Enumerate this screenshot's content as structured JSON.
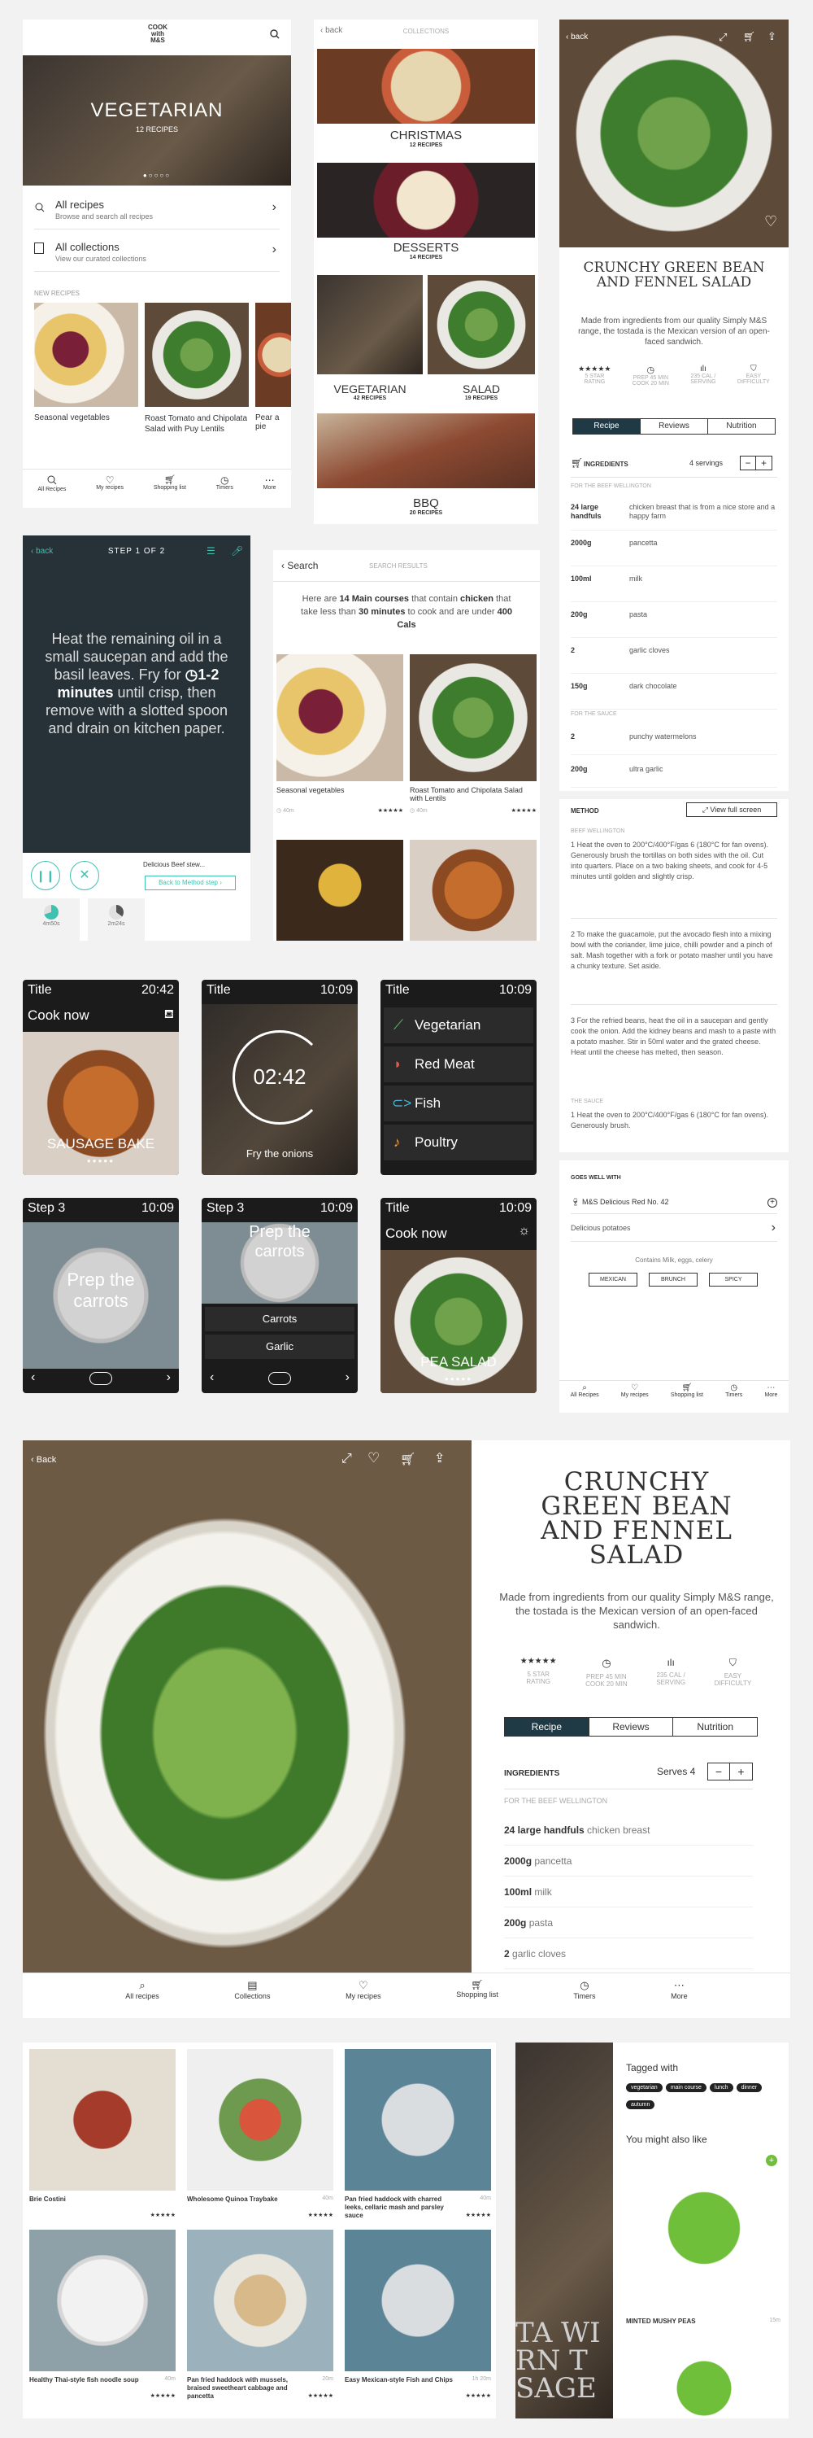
{
  "panel1": {
    "brand": "COOK\nwith\nM&S",
    "hero_title": "VEGETARIAN",
    "hero_subtitle": "12 RECIPES",
    "all_recipes": {
      "title": "All recipes",
      "subtitle": "Browse and search all recipes"
    },
    "all_collections": {
      "title": "All collections",
      "subtitle": "View our curated collections"
    },
    "new_recipes_label": "NEW RECIPES",
    "cards": [
      "Seasonal vegetables",
      "Roast Tomato and Chipolata Salad with Puy Lentils",
      "Pear a pie"
    ],
    "tabs": [
      "All Recipes",
      "My recipes",
      "Shopping list",
      "Timers",
      "More"
    ]
  },
  "panel2": {
    "back": "back",
    "title": "COLLECTIONS",
    "collections": [
      {
        "name": "CHRISTMAS",
        "count": "12 RECIPES"
      },
      {
        "name": "DESSERTS",
        "count": "14 RECIPES"
      },
      {
        "name": "VEGETARIAN",
        "count": "42 RECIPES"
      },
      {
        "name": "SALAD",
        "count": "19 RECIPES"
      },
      {
        "name": "BBQ",
        "count": "20 RECIPES"
      }
    ]
  },
  "panel3": {
    "back": "back",
    "title": "CRUNCHY GREEN BEAN AND FENNEL SALAD",
    "desc": "Made from ingredients from our quality Simply M&S range, the tostada is the Mexican version of an open-faced sandwich.",
    "stats": [
      {
        "value": "★★★★★",
        "label": "5 STAR\nRATING"
      },
      {
        "value": "◷",
        "label": "PREP 45 MIN\nCOOK 20 MIN"
      },
      {
        "value": "ılı",
        "label": "235 CAL /\nSERVING"
      },
      {
        "value": "⛉",
        "label": "EASY\nDIFFICULTY"
      }
    ],
    "tabs": [
      "Recipe",
      "Reviews",
      "Nutrition"
    ],
    "ingredients_label": "INGREDIENTS",
    "servings": "4 servings",
    "section1": "FOR THE BEEF WELLINGTON",
    "ingredients": [
      {
        "qty": "24 large\nhandfuls",
        "item": "chicken breast that is from a nice store and a happy farm"
      },
      {
        "qty": "2000g",
        "item": "pancetta"
      },
      {
        "qty": "100ml",
        "item": "milk"
      },
      {
        "qty": "200g",
        "item": "pasta"
      },
      {
        "qty": "2",
        "item": "garlic cloves"
      },
      {
        "qty": "150g",
        "item": "dark chocolate"
      }
    ],
    "section2": "FOR THE SAUCE",
    "sauce": [
      {
        "qty": "2",
        "item": "punchy watermelons"
      },
      {
        "qty": "200g",
        "item": "ultra garlic"
      }
    ],
    "method_label": "METHOD",
    "view_full": "View full screen",
    "method_section": "BEEF WELLINGTON",
    "steps": [
      "1  Heat the oven to 200°C/400°F/gas 6 (180°C for fan ovens). Generously brush the tortillas on both sides with the oil. Cut into quarters. Place on a two baking sheets, and cook for 4-5 minutes until golden and slightly crisp.",
      "2  To make the guacamole, put the avocado flesh into a mixing bowl with the coriander, lime juice, chilli powder and a pinch of salt. Mash together with a fork or potato masher until you have a chunky texture. Set aside.",
      "3  For the refried beans, heat the oil in a saucepan and gently cook the onion. Add the kidney beans and mash to a paste with a potato masher. Stir in 50ml water and the grated cheese. Heat until the cheese has melted, then season."
    ],
    "sauce_section": "THE SAUCE",
    "sauce_step": "1  Heat the oven to 200°C/400°F/gas 6 (180°C for fan ovens). Generously brush.",
    "goes_well": "GOES WELL WITH",
    "pair1": "M&S Delicious Red No. 42",
    "pair2": "Delicious potatoes",
    "contains": "Contains Milk, eggs, celery",
    "tags": [
      "MEXICAN",
      "BRUNCH",
      "SPICY"
    ],
    "nav": [
      "All Recipes",
      "My recipes",
      "Shopping list",
      "Timers",
      "More"
    ]
  },
  "panel4": {
    "back": "back",
    "step": "STEP 1 OF 2",
    "text_pre": "Heat the remaining oil in a small saucepan and add the basil leaves. Fry for",
    "text_bold": "1-2 minutes",
    "text_post": "until crisp, then remove with a slotted spoon and drain on kitchen paper.",
    "recipe": "Delicious Beef stew...",
    "back_method": "Back to Method step",
    "timers": [
      "4m50s",
      "2m24s"
    ]
  },
  "panel5": {
    "search": "Search",
    "results_label": "SEARCH RESULTS",
    "summary_a": "Here are ",
    "summary_b": "14 Main courses",
    "summary_c": " that contain ",
    "summary_d": "chicken",
    "summary_e": " that take less than ",
    "summary_f": "30 minutes",
    "summary_g": " to cook and are under ",
    "summary_h": "400 Cals",
    "results": [
      {
        "name": "Seasonal vegetables",
        "time": "40m"
      },
      {
        "name": "Roast Tomato and Chipolata Salad with Lentils",
        "time": "40m"
      }
    ]
  },
  "watches": [
    {
      "title": "Title",
      "time": "20:42",
      "label": "Cook now",
      "caption": "SAUSAGE BAKE"
    },
    {
      "title": "Title",
      "time": "10:09",
      "timer": "02:42",
      "caption": "Fry the onions"
    },
    {
      "title": "Title",
      "time": "10:09",
      "menu": [
        "Vegetarian",
        "Red Meat",
        "Fish",
        "Poultry"
      ]
    },
    {
      "title": "Step 3",
      "time": "10:09",
      "caption": "Prep the carrots"
    },
    {
      "title": "Step 3",
      "time": "10:09",
      "caption": "Prep the carrots",
      "list": [
        "Carrots",
        "Garlic"
      ]
    },
    {
      "title": "Title",
      "time": "10:09",
      "label": "Cook now",
      "caption": "PEA SALAD"
    }
  ],
  "tablet": {
    "back": "Back",
    "title": "CRUNCHY GREEN BEAN AND FENNEL SALAD",
    "desc": "Made from ingredients from our quality Simply M&S range, the tostada is the Mexican version of an open-faced sandwich.",
    "stats": [
      {
        "value": "★★★★★",
        "label": "5 STAR\nRATING"
      },
      {
        "value": "◷",
        "label": "PREP 45 MIN\nCOOK 20 MIN"
      },
      {
        "value": "ılı",
        "label": "235 CAL /\nSERVING"
      },
      {
        "value": "⛉",
        "label": "EASY\nDIFFICULTY"
      }
    ],
    "tabs": [
      "Recipe",
      "Reviews",
      "Nutrition"
    ],
    "ingredients_label": "INGREDIENTS",
    "serves": "Serves 4",
    "section": "FOR THE BEEF WELLINGTON",
    "ingredients": [
      {
        "qty": "24 large handfuls",
        "item": "chicken breast"
      },
      {
        "qty": "2000g",
        "item": "pancetta"
      },
      {
        "qty": "100ml",
        "item": "milk"
      },
      {
        "qty": "200g",
        "item": "pasta"
      },
      {
        "qty": "2",
        "item": "garlic cloves"
      }
    ],
    "nav": [
      "All recipes",
      "Collections",
      "My recipes",
      "Shopping list",
      "Timers",
      "More"
    ]
  },
  "grid": {
    "items": [
      {
        "name": "Brie Costini",
        "time": ""
      },
      {
        "name": "Wholesome Quinoa Traybake",
        "time": "40m"
      },
      {
        "name": "Pan fried haddock with charred leeks, cellaric mash and parsley sauce",
        "time": "40m"
      },
      {
        "name": "Healthy Thai-style fish noodle soup",
        "time": "40m"
      },
      {
        "name": "Pan fried haddock with mussels, braised sweetheart cabbage and pancetta",
        "time": "20m"
      },
      {
        "name": "Easy Mexican-style Fish and Chips",
        "time": "1h 20m"
      }
    ]
  },
  "tags_panel": {
    "tagged": "Tagged with",
    "tags": [
      "vegetarian",
      "main course",
      "lunch",
      "dinner",
      "autumn"
    ],
    "also_like": "You might also like",
    "item": "MINTED MUSHY PEAS",
    "item_time": "15m",
    "side_text": "TA WI\nRN T\nSAGE"
  }
}
